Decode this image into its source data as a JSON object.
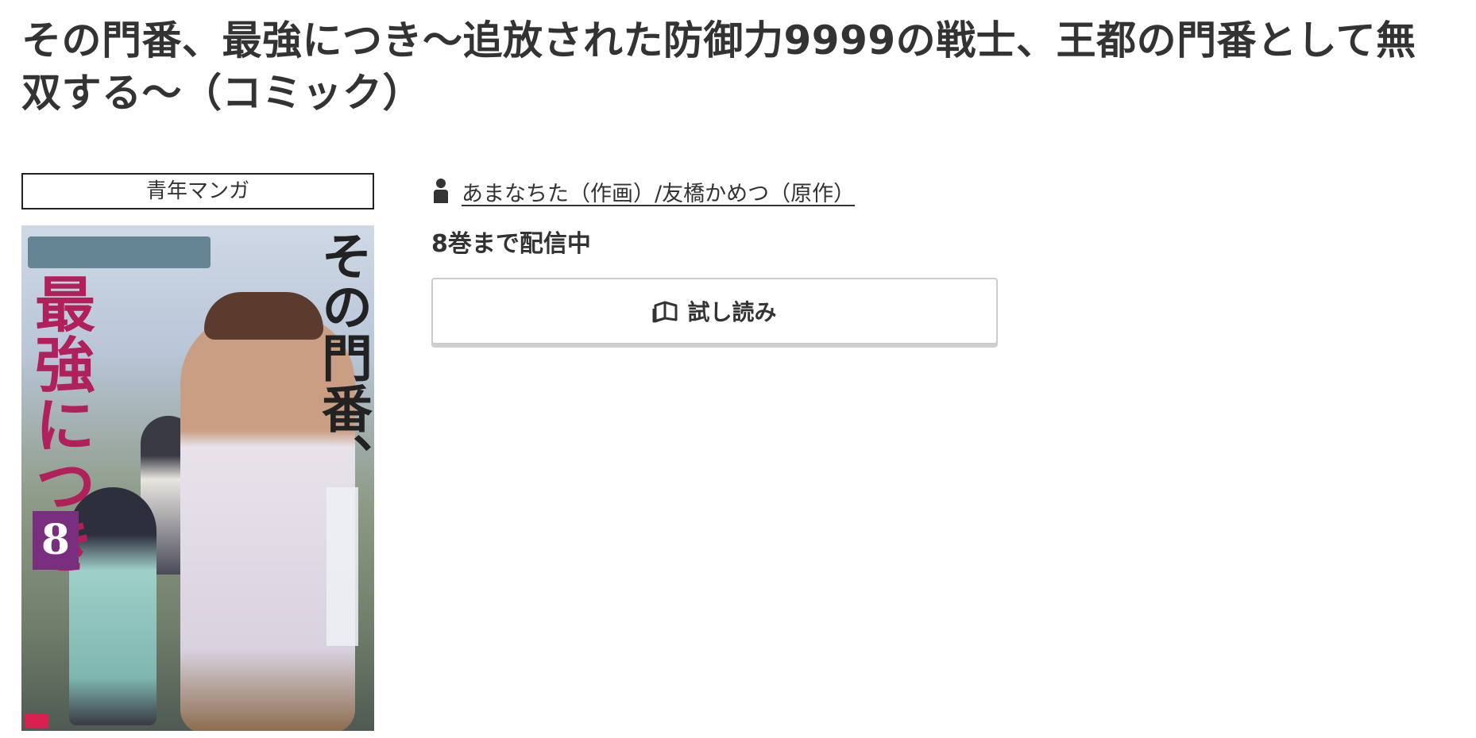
{
  "title": "その門番、最強につき〜追放された防御力9999の戦士、王都の門番として無双する〜（コミック）",
  "genre": "青年マンガ",
  "cover": {
    "title_top": "その門番、",
    "title_main": "最強につき",
    "volume": "8"
  },
  "author": {
    "icon": "person-icon",
    "label": "あまなちた（作画）/友橋かめつ（原作）"
  },
  "availability": "8巻まで配信中",
  "trial_button": {
    "icon": "book-open-icon",
    "label": "試し読み"
  }
}
